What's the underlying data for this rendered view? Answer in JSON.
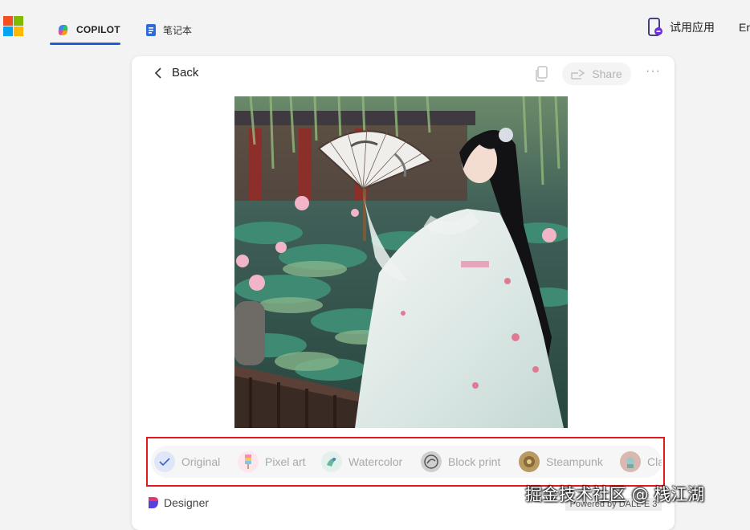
{
  "nav": {
    "copilot_tab": "COPILOT",
    "notebook_tab": "笔记本",
    "try_app": "试用应用",
    "language_cut": "Er"
  },
  "card": {
    "back_label": "Back",
    "share_label": "Share",
    "more_label": "···"
  },
  "styles": [
    {
      "label": "Original",
      "selected": true
    },
    {
      "label": "Pixel art",
      "selected": false
    },
    {
      "label": "Watercolor",
      "selected": false
    },
    {
      "label": "Block print",
      "selected": false
    },
    {
      "label": "Steampunk",
      "selected": false
    },
    {
      "label": "Cla",
      "selected": false
    }
  ],
  "footer": {
    "designer_label": "Designer",
    "powered_by": "Powered by DALL·E 3"
  },
  "watermark": "掘金技术社区 @ 栈江湖",
  "colors": {
    "accent": "#1f5fd6",
    "highlight_box": "#e0191f",
    "ms_red": "#f25022",
    "ms_green": "#7fba00",
    "ms_blue": "#00a4ef",
    "ms_yellow": "#ffb900"
  }
}
